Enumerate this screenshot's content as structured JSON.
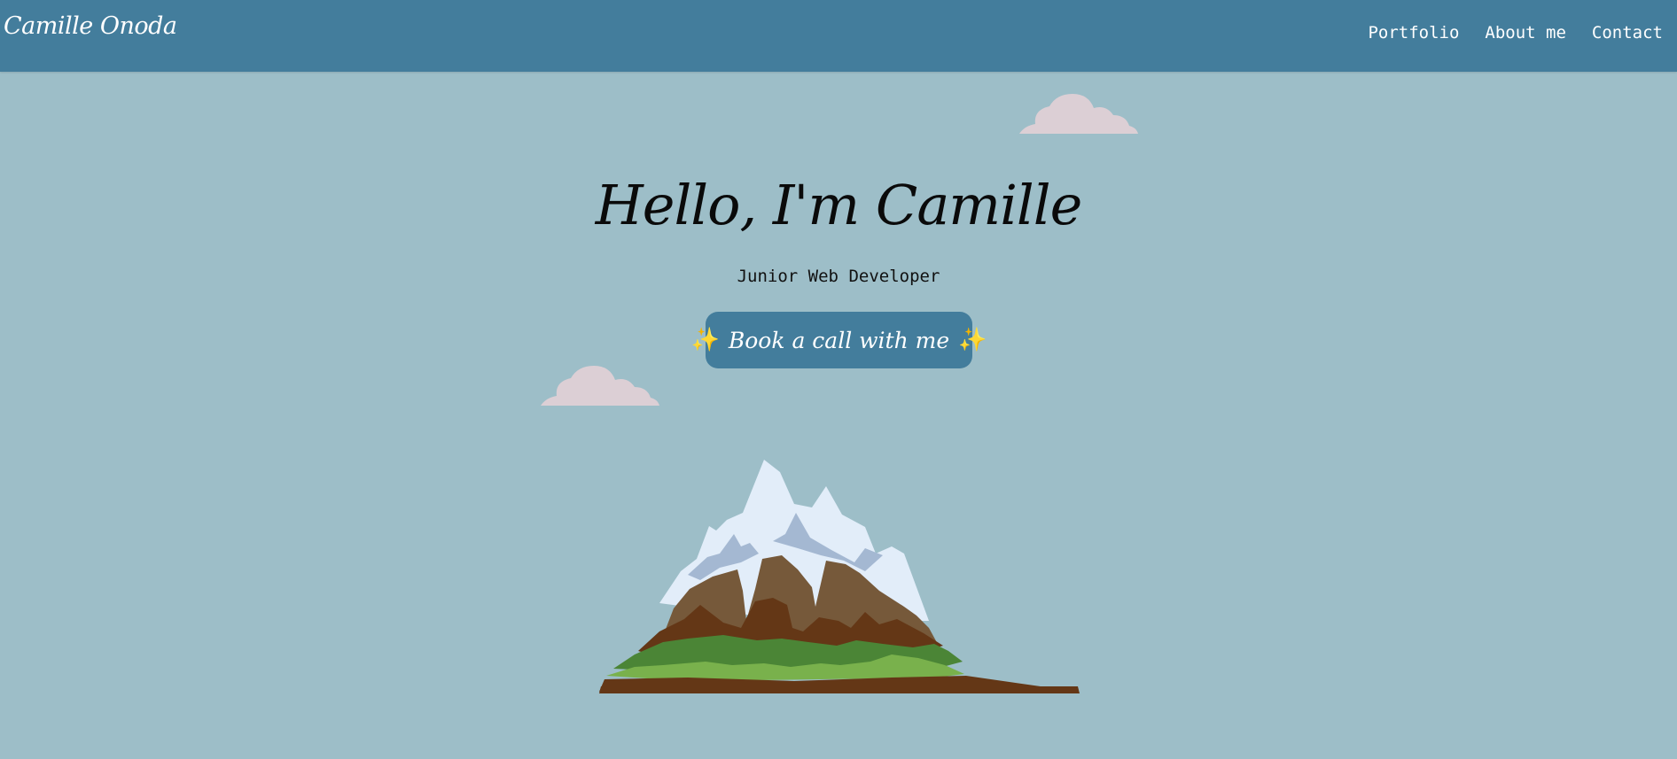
{
  "header": {
    "brand": "Camille Onoda",
    "nav": [
      {
        "label": "Portfolio"
      },
      {
        "label": "About me"
      },
      {
        "label": "Contact"
      }
    ]
  },
  "hero": {
    "title": "Hello, I'm Camille",
    "subtitle": "Junior Web Developer",
    "cta": {
      "label": "Book a call with me",
      "icon_left": "✨",
      "icon_right": "✨"
    }
  },
  "colors": {
    "nav_bg": "#437d9c",
    "page_bg": "#9dbec8",
    "cloud": "#dccfd5",
    "sparkle": "#f7c843",
    "text_light": "#ffffff",
    "text_dark": "#0a0a0a"
  },
  "decorations": {
    "clouds": [
      "cloud-icon",
      "cloud-icon"
    ],
    "illustration": "mountain-illustration"
  }
}
